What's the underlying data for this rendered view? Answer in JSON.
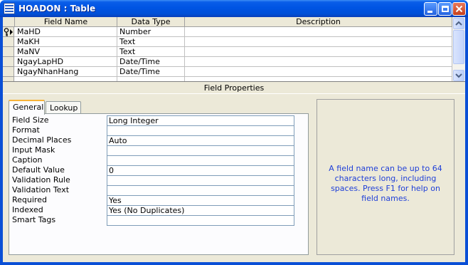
{
  "window": {
    "title": "HOADON : Table"
  },
  "grid": {
    "columns": [
      "Field Name",
      "Data Type",
      "Description"
    ],
    "rows": [
      {
        "name": "MaHD",
        "type": "Number",
        "desc": ""
      },
      {
        "name": "MaKH",
        "type": "Text",
        "desc": ""
      },
      {
        "name": "MaNV",
        "type": "Text",
        "desc": ""
      },
      {
        "name": "NgayLapHD",
        "type": "Date/Time",
        "desc": ""
      },
      {
        "name": "NgayNhanHang",
        "type": "Date/Time",
        "desc": ""
      }
    ]
  },
  "field_properties": {
    "label": "Field Properties",
    "tabs": [
      "General",
      "Lookup"
    ],
    "props": [
      {
        "name": "Field Size",
        "value": "Long Integer"
      },
      {
        "name": "Format",
        "value": ""
      },
      {
        "name": "Decimal Places",
        "value": "Auto"
      },
      {
        "name": "Input Mask",
        "value": ""
      },
      {
        "name": "Caption",
        "value": ""
      },
      {
        "name": "Default Value",
        "value": "0"
      },
      {
        "name": "Validation Rule",
        "value": ""
      },
      {
        "name": "Validation Text",
        "value": ""
      },
      {
        "name": "Required",
        "value": "Yes"
      },
      {
        "name": "Indexed",
        "value": "Yes (No Duplicates)"
      },
      {
        "name": "Smart Tags",
        "value": ""
      }
    ],
    "help_text": "A field name can be up to 64 characters long, including spaces. Press F1 for help on field names."
  },
  "icons": {
    "app": "table-icon",
    "primary_key": "key-icon",
    "current_row": "row-pointer-icon",
    "minimize": "minimize-icon",
    "restore": "restore-icon",
    "close": "close-icon"
  },
  "colors": {
    "titlebar": "#0054e3",
    "help_text": "#1f3fd8",
    "active_tab_accent": "#f8b338"
  }
}
